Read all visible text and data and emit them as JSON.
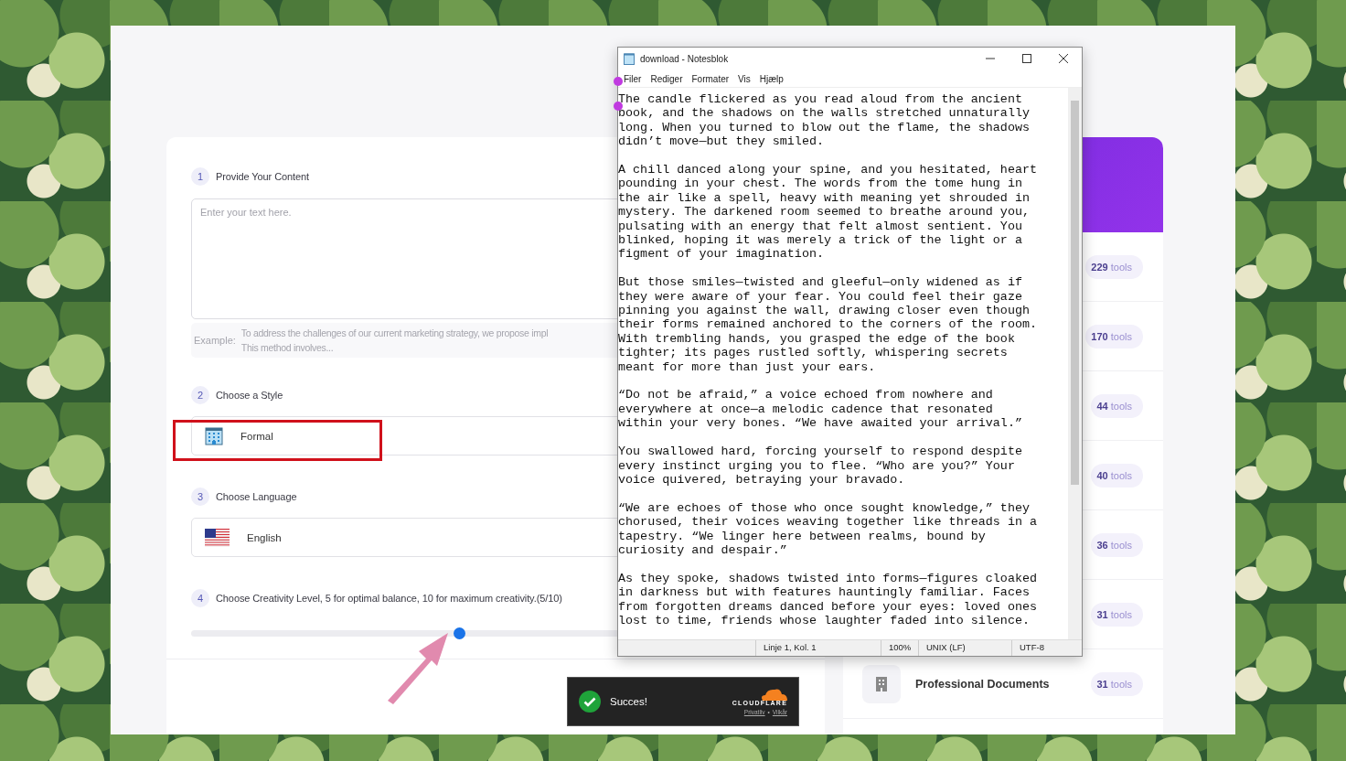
{
  "content": {
    "number": "1",
    "label": "Provide Your Content",
    "placeholder": "Enter your text here.",
    "example_label": "Example:",
    "example_lines": [
      "To address the challenges of our current marketing strategy, we propose impl",
      "This method involves..."
    ]
  },
  "style": {
    "number": "2",
    "label": "Choose a Style",
    "value": "Formal"
  },
  "language": {
    "number": "3",
    "label": "Choose Language",
    "value": "English"
  },
  "creativity": {
    "number": "4",
    "label": "Choose Creativity Level, 5 for optimal balance, 10 for maximum creativity.(5/10)",
    "level": 0.44
  },
  "annotations": {
    "frame": true,
    "arrow": true
  },
  "categories": [
    {
      "count": "229",
      "unit": "tools"
    },
    {
      "count": "170",
      "unit": "tools"
    },
    {
      "count": "44",
      "unit": "tools"
    },
    {
      "count": "40",
      "unit": "tools"
    },
    {
      "count": "36",
      "unit": "tools"
    },
    {
      "count": "31",
      "unit": "tools"
    },
    {
      "name": "Professional Documents",
      "count": "31",
      "unit": "tools"
    }
  ],
  "notepad": {
    "title": "download - Notesblok",
    "menu": [
      "Filer",
      "Rediger",
      "Formater",
      "Vis",
      "Hjælp"
    ],
    "paragraphs": [
      [
        "The candle flickered as you read aloud from the ancient",
        "book, and the shadows on the walls stretched unnaturally",
        "long. When you turned to blow out the flame, the shadows",
        "didn’t move—but they smiled."
      ],
      [
        "A chill danced along your spine, and you hesitated, heart",
        "pounding in your chest. The words from the tome hung in",
        "the air like a spell, heavy with meaning yet shrouded in",
        "mystery. The darkened room seemed to breathe around you,",
        "pulsating with an energy that felt almost sentient. You",
        "blinked, hoping it was merely a trick of the light or a",
        "figment of your imagination."
      ],
      [
        "But those smiles—twisted and gleeful—only widened as if",
        "they were aware of your fear. You could feel their gaze",
        "pinning you against the wall, drawing closer even though",
        "their forms remained anchored to the corners of the room.",
        "With trembling hands, you grasped the edge of the book",
        "tighter; its pages rustled softly, whispering secrets",
        "meant for more than just your ears."
      ],
      [
        "“Do not be afraid,” a voice echoed from nowhere and",
        "everywhere at once—a melodic cadence that resonated",
        "within your very bones. “We have awaited your arrival.”"
      ],
      [
        "You swallowed hard, forcing yourself to respond despite",
        "every instinct urging you to flee. “Who are you?” Your",
        "voice quivered, betraying your bravado."
      ],
      [
        "“We are echoes of those who once sought knowledge,” they",
        "chorused, their voices weaving together like threads in a",
        "tapestry. “We linger here between realms, bound by",
        "curiosity and despair.”"
      ],
      [
        "As they spoke, shadows twisted into forms—figures cloaked",
        "in darkness but with features hauntingly familiar. Faces",
        "from forgotten dreams danced before your eyes: loved ones",
        "lost to time, friends whose laughter faded into silence."
      ]
    ],
    "status": [
      "Linje 1, Kol. 1",
      "100%",
      "UNIX (LF)",
      "UTF-8"
    ]
  },
  "toast": {
    "message": "Succes!",
    "brand": "CLOUDFLARE",
    "links": [
      "Privatliv",
      "Vilkår"
    ],
    "separator": "•"
  }
}
